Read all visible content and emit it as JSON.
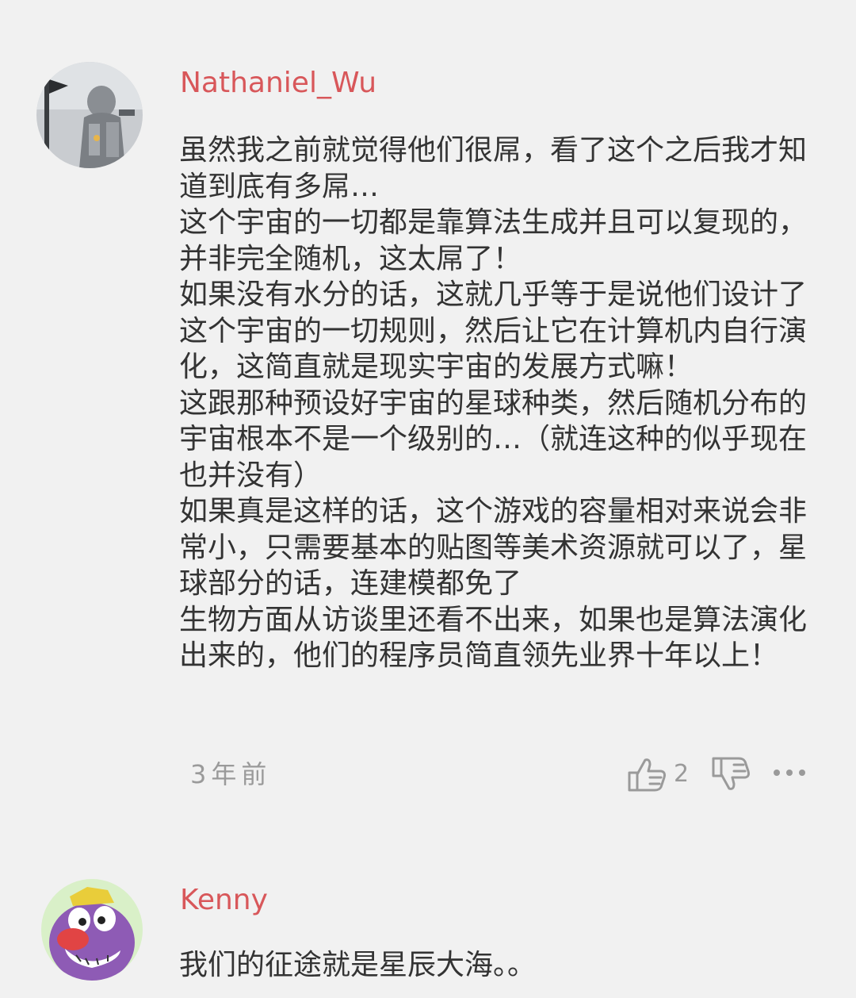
{
  "comments": [
    {
      "username": "Nathaniel_Wu",
      "avatar": "astronaut-robot-avatar",
      "body": "虽然我之前就觉得他们很屌，看了这个之后我才知道到底有多屌…\n这个宇宙的一切都是靠算法生成并且可以复现的，并非完全随机，这太屌了！\n如果没有水分的话，这就几乎等于是说他们设计了这个宇宙的一切规则，然后让它在计算机内自行演化，这简直就是现实宇宙的发展方式嘛！\n这跟那种预设好宇宙的星球种类，然后随机分布的宇宙根本不是一个级别的…（就连这种的似乎现在也并没有）\n如果真是这样的话，这个游戏的容量相对来说会非常小，只需要基本的贴图等美术资源就可以了，星球部分的话，连建模都免了\n生物方面从访谈里还看不出来，如果也是算法演化出来的，他们的程序员简直领先业界十年以上！",
      "time": "3年前",
      "likes": "2"
    },
    {
      "username": "Kenny",
      "avatar": "purple-cartoon-character-avatar",
      "body": "我们的征途就是星辰大海。。"
    }
  ],
  "icons": {
    "like": "thumbs-up-icon",
    "dislike": "thumbs-down-icon",
    "more": "more-dots-icon"
  },
  "colors": {
    "username": "#d8575a",
    "background": "#f1f1f1",
    "text": "#333333",
    "meta": "#9a9a9a"
  }
}
